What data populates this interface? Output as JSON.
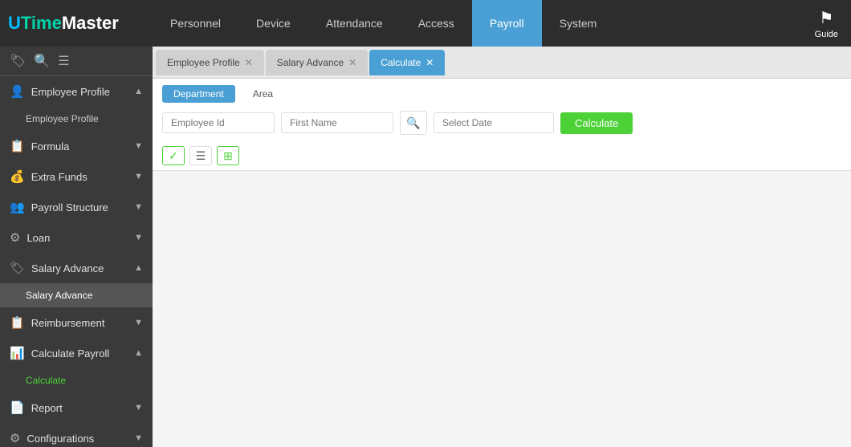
{
  "logo": {
    "u": "U",
    "time": "Time",
    "master": " Master"
  },
  "nav": {
    "items": [
      {
        "label": "Personnel",
        "active": false
      },
      {
        "label": "Device",
        "active": false
      },
      {
        "label": "Attendance",
        "active": false
      },
      {
        "label": "Access",
        "active": false
      },
      {
        "label": "Payroll",
        "active": true
      },
      {
        "label": "System",
        "active": false
      }
    ],
    "guide_label": "Guide"
  },
  "sidebar": {
    "top_icons": [
      "🏷",
      "🔍",
      "☰"
    ],
    "sections": [
      {
        "id": "employee-profile",
        "icon": "👤",
        "label": "Employee Profile",
        "expanded": true,
        "chevron": "▲",
        "subitems": [
          {
            "label": "Employee Profile",
            "active": false
          }
        ]
      },
      {
        "id": "formula",
        "icon": "📋",
        "label": "Formula",
        "expanded": false,
        "chevron": "▼",
        "subitems": []
      },
      {
        "id": "extra-funds",
        "icon": "💰",
        "label": "Extra Funds",
        "expanded": false,
        "chevron": "▼",
        "subitems": []
      },
      {
        "id": "payroll-structure",
        "icon": "👥",
        "label": "Payroll Structure",
        "expanded": false,
        "chevron": "▼",
        "subitems": []
      },
      {
        "id": "loan",
        "icon": "⚙",
        "label": "Loan",
        "expanded": false,
        "chevron": "▼",
        "subitems": []
      },
      {
        "id": "salary-advance",
        "icon": "🏷",
        "label": "Salary Advance",
        "expanded": true,
        "chevron": "▲",
        "subitems": [
          {
            "label": "Salary Advance",
            "active": true
          }
        ]
      },
      {
        "id": "reimbursement",
        "icon": "📋",
        "label": "Reimbursement",
        "expanded": false,
        "chevron": "▼",
        "subitems": []
      },
      {
        "id": "calculate-payroll",
        "icon": "📊",
        "label": "Calculate Payroll",
        "expanded": true,
        "chevron": "▲",
        "subitems": [
          {
            "label": "Calculate",
            "active": false,
            "green": true
          }
        ]
      },
      {
        "id": "report",
        "icon": "📄",
        "label": "Report",
        "expanded": false,
        "chevron": "▼",
        "subitems": []
      },
      {
        "id": "configurations",
        "icon": "⚙",
        "label": "Configurations",
        "expanded": false,
        "chevron": "▼",
        "subitems": []
      }
    ]
  },
  "tabs": [
    {
      "label": "Employee Profile",
      "active": false,
      "closable": true
    },
    {
      "label": "Salary Advance",
      "active": false,
      "closable": true
    },
    {
      "label": "Calculate",
      "active": true,
      "closable": true
    }
  ],
  "sub_tabs": [
    {
      "label": "Department",
      "active": true
    },
    {
      "label": "Area",
      "active": false
    }
  ],
  "filter": {
    "employee_id_placeholder": "Employee Id",
    "first_name_placeholder": "First Name",
    "date_placeholder": "Select Date",
    "calculate_label": "Calculate"
  },
  "icons_row": [
    {
      "name": "check-icon",
      "symbol": "✓",
      "color": "green"
    },
    {
      "name": "list-icon",
      "symbol": "☰",
      "color": "normal"
    },
    {
      "name": "tree-icon",
      "symbol": "⊞",
      "color": "green"
    }
  ]
}
